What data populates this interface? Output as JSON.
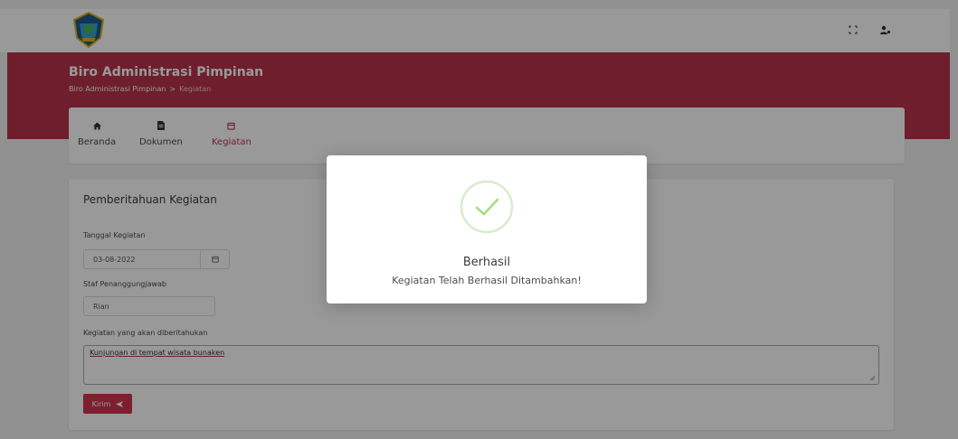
{
  "header": {
    "title": "Biro Administrasi Pimpinan",
    "breadcrumb": [
      "Biro Administrasi Pimpinan",
      ">",
      "Kegiatan"
    ]
  },
  "nav": {
    "items": [
      {
        "label": "Beranda",
        "icon": "home-icon"
      },
      {
        "label": "Dokumen",
        "icon": "document-icon"
      },
      {
        "label": "Kegiatan",
        "icon": "calendar-icon"
      }
    ],
    "active": "Kegiatan"
  },
  "form": {
    "title": "Pemberitahuan Kegiatan",
    "date_label": "Tanggal Kegiatan",
    "date_value": "03-08-2022",
    "staff_label": "Staf Penanggungjawab",
    "staff_value": "Rian",
    "activity_label": "Kegiatan yang akan diberitahukan",
    "activity_value": "Kunjungan di tempat wisata bunaken",
    "submit_label": "Kirim"
  },
  "modal": {
    "title": "Berhasil",
    "message": "Kegiatan Telah Berhasil Ditambahkan!",
    "icon": "success-check-icon"
  },
  "colors": {
    "brand": "#b8334a",
    "accent": "#d0344f",
    "success": "#a5dc86"
  },
  "top_icons": [
    "fullscreen-icon",
    "user-settings-icon"
  ]
}
